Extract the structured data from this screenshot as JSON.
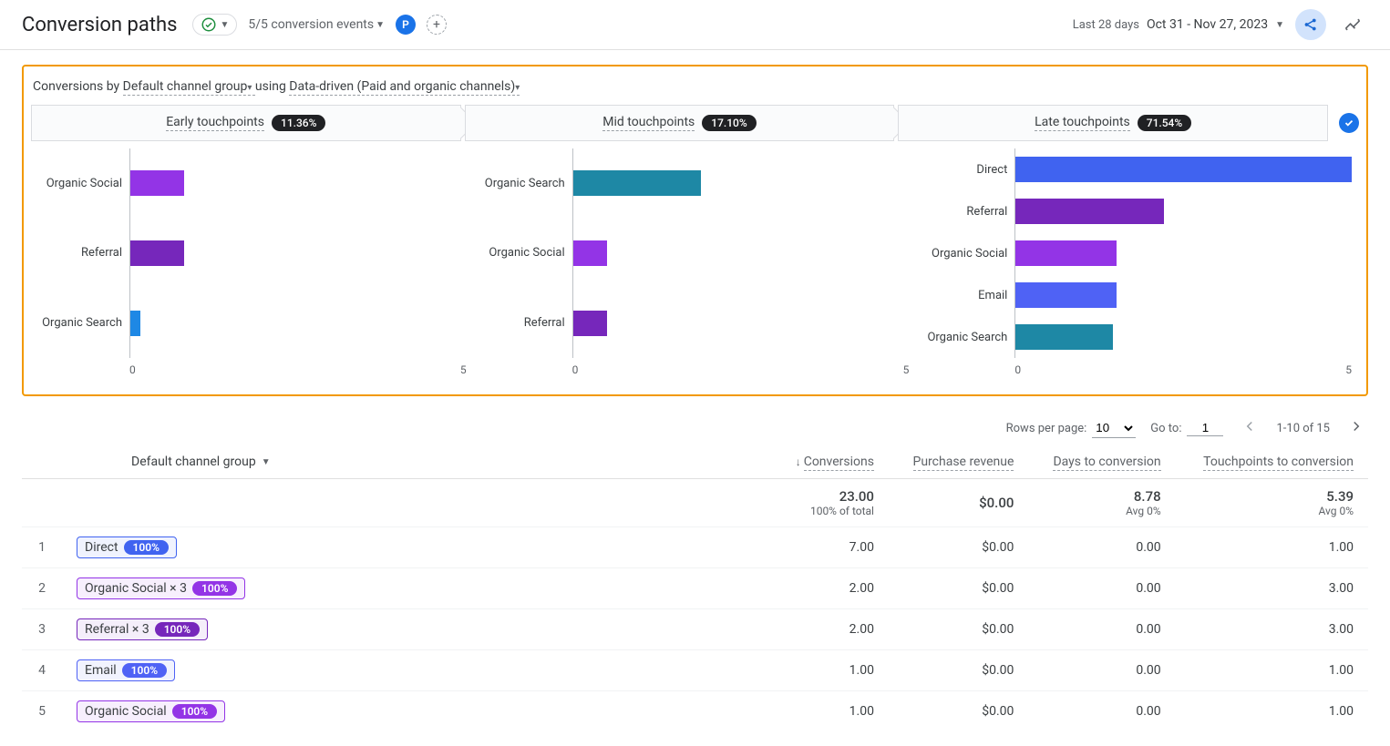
{
  "header": {
    "title": "Conversion paths",
    "events_filter": "5/5 conversion events",
    "segment_badge": "P",
    "date_label": "Last 28 days",
    "date_range": "Oct 31 - Nov 27, 2023"
  },
  "card": {
    "prefix": "Conversions by",
    "dim_label": "Default channel group",
    "mid": " using ",
    "model_label": "Data-driven (Paid and organic channels)",
    "steps": [
      {
        "label": "Early touchpoints",
        "pct": "11.36%"
      },
      {
        "label": "Mid touchpoints",
        "pct": "17.10%"
      },
      {
        "label": "Late touchpoints",
        "pct": "71.54%"
      }
    ]
  },
  "chart_data": [
    {
      "type": "bar",
      "orientation": "horizontal",
      "title": "Early touchpoints",
      "share": "11.36%",
      "xlim": [
        0,
        5
      ],
      "categories": [
        "Organic Social",
        "Referral",
        "Organic Search"
      ],
      "values": [
        0.8,
        0.8,
        0.15
      ],
      "colors": [
        "#9334e6",
        "#7627bb",
        "#1e88e5"
      ]
    },
    {
      "type": "bar",
      "orientation": "horizontal",
      "title": "Mid touchpoints",
      "share": "17.10%",
      "xlim": [
        0,
        5
      ],
      "categories": [
        "Organic Search",
        "Organic Social",
        "Referral"
      ],
      "values": [
        1.9,
        0.5,
        0.5
      ],
      "colors": [
        "#1e88a5",
        "#9334e6",
        "#7627bb"
      ]
    },
    {
      "type": "bar",
      "orientation": "horizontal",
      "title": "Late touchpoints",
      "share": "71.54%",
      "xlim": [
        0,
        5
      ],
      "categories": [
        "Direct",
        "Referral",
        "Organic Social",
        "Email",
        "Organic Search"
      ],
      "values": [
        5.0,
        2.2,
        1.5,
        1.5,
        1.45
      ],
      "colors": [
        "#4063f0",
        "#7627bb",
        "#9334e6",
        "#4f62f5",
        "#1e88a5"
      ]
    }
  ],
  "colors": {
    "Direct": "#4063f0",
    "Organic Social": "#9334e6",
    "Referral": "#7627bb",
    "Email": "#4f62f5",
    "Organic Search": "#1e88a5"
  },
  "table": {
    "channel_dropdown": "Default channel group",
    "controls": {
      "rows_label": "Rows per page:",
      "rows_value": "10",
      "goto_label": "Go to:",
      "goto_value": "1",
      "range": "1-10 of 15"
    },
    "columns": [
      "Conversions",
      "Purchase revenue",
      "Days to conversion",
      "Touchpoints to conversion"
    ],
    "summary": {
      "conversions": "23.00",
      "conversions_sub": "100% of total",
      "revenue": "$0.00",
      "days": "8.78",
      "days_sub": "Avg 0%",
      "touchpoints": "5.39",
      "touchpoints_sub": "Avg 0%"
    },
    "rows": [
      {
        "idx": 1,
        "path": [
          {
            "channel": "Direct",
            "mult": "",
            "pct": "100%"
          }
        ],
        "conversions": "7.00",
        "revenue": "$0.00",
        "days": "0.00",
        "touchpoints": "1.00"
      },
      {
        "idx": 2,
        "path": [
          {
            "channel": "Organic Social",
            "mult": " × 3",
            "pct": "100%"
          }
        ],
        "conversions": "2.00",
        "revenue": "$0.00",
        "days": "0.00",
        "touchpoints": "3.00"
      },
      {
        "idx": 3,
        "path": [
          {
            "channel": "Referral",
            "mult": " × 3",
            "pct": "100%"
          }
        ],
        "conversions": "2.00",
        "revenue": "$0.00",
        "days": "0.00",
        "touchpoints": "3.00"
      },
      {
        "idx": 4,
        "path": [
          {
            "channel": "Email",
            "mult": "",
            "pct": "100%"
          }
        ],
        "conversions": "1.00",
        "revenue": "$0.00",
        "days": "0.00",
        "touchpoints": "1.00"
      },
      {
        "idx": 5,
        "path": [
          {
            "channel": "Organic Social",
            "mult": "",
            "pct": "100%"
          }
        ],
        "conversions": "1.00",
        "revenue": "$0.00",
        "days": "0.00",
        "touchpoints": "1.00"
      }
    ]
  }
}
